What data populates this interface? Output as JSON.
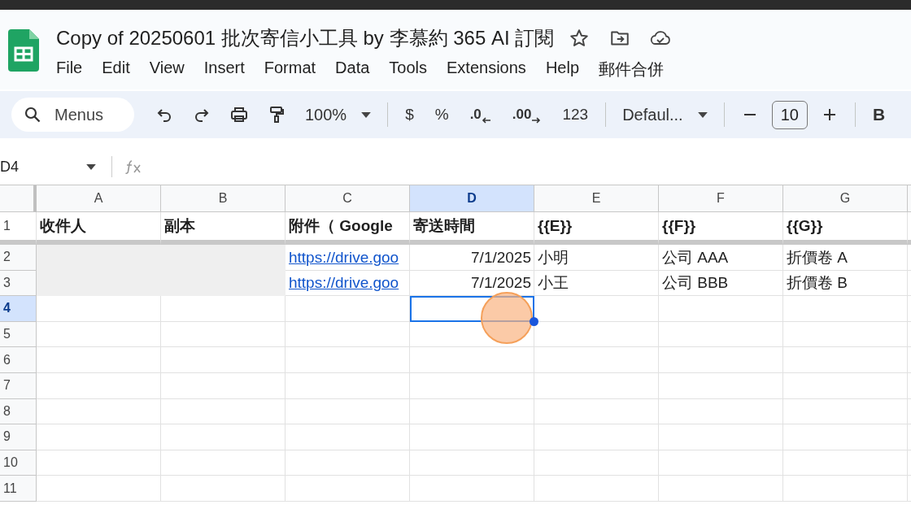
{
  "document": {
    "title": "Copy of 20250601 批次寄信小工具 by 李慕約 365 AI 訂閱"
  },
  "menu": [
    "File",
    "Edit",
    "View",
    "Insert",
    "Format",
    "Data",
    "Tools",
    "Extensions",
    "Help",
    "郵件合併"
  ],
  "toolbar": {
    "search": {
      "placeholder": "Menus"
    },
    "items": [
      {
        "kind": "undo"
      },
      {
        "kind": "redo"
      },
      {
        "kind": "print"
      },
      {
        "kind": "paint"
      },
      {
        "kind": "dropdown",
        "text": "100%"
      },
      {
        "kind": "divider"
      },
      {
        "kind": "text",
        "text": "$"
      },
      {
        "kind": "text",
        "text": "%"
      },
      {
        "kind": "decimal-less",
        "text": ".0"
      },
      {
        "kind": "decimal-more",
        "text": ".00"
      },
      {
        "kind": "text",
        "text": "123"
      },
      {
        "kind": "divider"
      },
      {
        "kind": "dropdown",
        "text": "Defaul..."
      },
      {
        "kind": "divider"
      },
      {
        "kind": "minus"
      },
      {
        "kind": "size",
        "text": "10"
      },
      {
        "kind": "plus"
      },
      {
        "kind": "divider"
      },
      {
        "kind": "bold",
        "text": "B"
      }
    ]
  },
  "formula_bar": {
    "name_box": "D4"
  },
  "sheet": {
    "columns": [
      {
        "label": "A",
        "selected": false
      },
      {
        "label": "B",
        "selected": false
      },
      {
        "label": "C",
        "selected": false
      },
      {
        "label": "D",
        "selected": true
      },
      {
        "label": "E",
        "selected": false
      },
      {
        "label": "F",
        "selected": false
      },
      {
        "label": "G",
        "selected": false
      }
    ],
    "rows": [
      {
        "label": "1",
        "selected": false,
        "cells": [
          {
            "kind": "header",
            "text": "收件人"
          },
          {
            "kind": "header",
            "text": "副本"
          },
          {
            "kind": "header",
            "text": "附件（ Google"
          },
          {
            "kind": "header",
            "text": "寄送時間"
          },
          {
            "kind": "header",
            "text": "{{E}}"
          },
          {
            "kind": "header",
            "text": "{{F}}"
          },
          {
            "kind": "header",
            "text": "{{G}}"
          }
        ]
      },
      {
        "label": "2",
        "selected": false,
        "cells": [
          {
            "kind": "redacted"
          },
          {
            "kind": "redacted"
          },
          {
            "kind": "link",
            "text": "https://drive.goo"
          },
          {
            "kind": "date",
            "text": "7/1/2025"
          },
          {
            "kind": "text",
            "text": "小明"
          },
          {
            "kind": "text",
            "text": "公司 AAA"
          },
          {
            "kind": "text",
            "text": "折價卷 A"
          }
        ]
      },
      {
        "label": "3",
        "selected": false,
        "cells": [
          {
            "kind": "redacted"
          },
          {
            "kind": "redacted"
          },
          {
            "kind": "link",
            "text": "https://drive.goo"
          },
          {
            "kind": "date",
            "text": "7/1/2025"
          },
          {
            "kind": "text",
            "text": "小王"
          },
          {
            "kind": "text",
            "text": "公司 BBB"
          },
          {
            "kind": "text",
            "text": "折價卷 B"
          }
        ]
      },
      {
        "label": "4",
        "selected": true,
        "cells": [
          {},
          {},
          {},
          {
            "selected": true
          },
          {},
          {},
          {}
        ]
      },
      {
        "label": "5",
        "selected": false,
        "cells": [
          {},
          {},
          {},
          {},
          {},
          {},
          {}
        ]
      },
      {
        "label": "6",
        "selected": false,
        "cells": [
          {},
          {},
          {},
          {},
          {},
          {},
          {}
        ]
      },
      {
        "label": "7",
        "selected": false,
        "cells": [
          {},
          {},
          {},
          {},
          {},
          {},
          {}
        ]
      },
      {
        "label": "8",
        "selected": false,
        "cells": [
          {},
          {},
          {},
          {},
          {},
          {},
          {}
        ]
      },
      {
        "label": "9",
        "selected": false,
        "cells": [
          {},
          {},
          {},
          {},
          {},
          {},
          {}
        ]
      },
      {
        "label": "10",
        "selected": false,
        "cells": [
          {},
          {},
          {},
          {},
          {},
          {},
          {}
        ]
      },
      {
        "label": "11",
        "selected": false,
        "cells": [
          {},
          {},
          {},
          {},
          {},
          {},
          {}
        ]
      }
    ]
  }
}
